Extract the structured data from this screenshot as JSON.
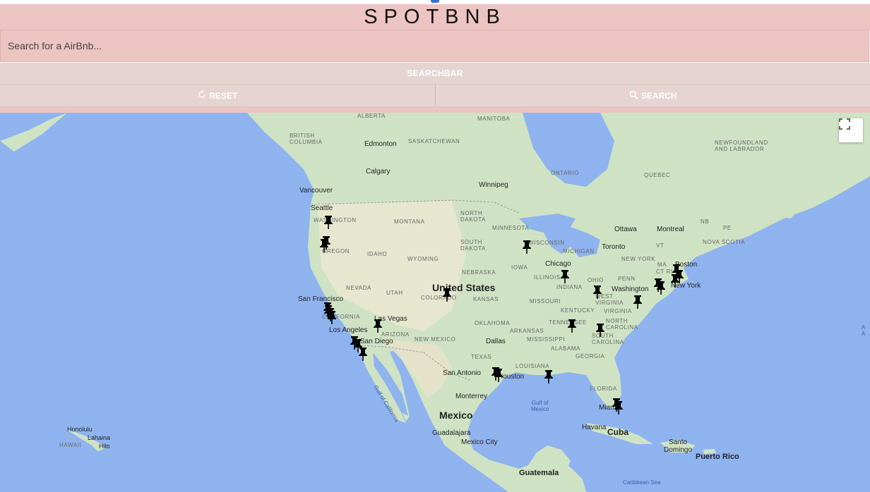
{
  "app": {
    "title": "SPOTBNB"
  },
  "search": {
    "placeholder": "Search for a AirBnb..."
  },
  "buttons": {
    "searchbar": "SEARCHBAR",
    "reset": "RESET",
    "search": "SEARCH"
  },
  "icons": {
    "reset": "refresh-icon",
    "search": "magnifier-icon",
    "fullscreen": "fullscreen-icon",
    "pin": "pushpin-icon"
  },
  "colors": {
    "header_bg": "#ecc4c2",
    "button_bg": "#e6d4d3",
    "ocean": "#8fb3ef",
    "land": "#cfe3c4",
    "pin": "#000000"
  },
  "map": {
    "labels": {
      "alberta": "ALBERTA",
      "manitoba": "MANITOBA",
      "british_columbia": "BRITISH\nCOLUMBIA",
      "saskatchewan": "SASKATCHEWAN",
      "edmonton": "Edmonton",
      "calgary": "Calgary",
      "ontario": "ONTARIO",
      "quebec": "QUEBEC",
      "newfoundland": "NEWFOUNDLAND\nAND LABRADOR",
      "winnipeg": "Winnipeg",
      "vancouver": "Vancouver",
      "seattle": "Seattle",
      "washington": "WASHINGTON",
      "montana": "MONTANA",
      "north_dakota": "NORTH\nDAKOTA",
      "minnesota": "MINNESOTA",
      "ottawa": "Ottawa",
      "montreal": "Montreal",
      "nb": "NB",
      "pe": "PE",
      "oregon": "OREGON",
      "idaho": "IDAHO",
      "wyoming": "WYOMING",
      "south_dakota": "SOUTH\nDAKOTA",
      "wisconsin": "WISCONSIN",
      "michigan": "MICHIGAN",
      "toronto": "Toronto",
      "vt": "VT",
      "nova_scotia": "NOVA SCOTIA",
      "new_york_state": "NEW YORK",
      "chicago": "Chicago",
      "nebraska": "NEBRASKA",
      "iowa": "IOWA",
      "ma": "MA",
      "boston": "Boston",
      "ct_ri": "CT RI",
      "new_york": "New York",
      "nevada": "NEVADA",
      "utah": "UTAH",
      "united_states": "United States",
      "illinois": "ILLINOIS",
      "indiana": "INDIANA",
      "ohio": "OHIO",
      "penn": "PENN",
      "washington_dc": "Washington",
      "san_francisco": "San Francisco",
      "colorado": "COLORADO",
      "kansas": "KANSAS",
      "missouri": "MISSOURI",
      "west_virginia": "WEST\nVIRGINIA",
      "virginia": "VIRGINIA",
      "california": "CALIFORNIA",
      "kentucky": "KENTUCKY",
      "las_vegas": "Las Vegas",
      "tennessee": "TENNESSEE",
      "north_carolina": "NORTH\nCAROLINA",
      "oklahoma": "OKLAHOMA",
      "los_angeles": "Los Angeles",
      "arizona": "ARIZONA",
      "arkansas": "ARKANSAS",
      "san_diego": "San Diego",
      "new_mexico": "NEW MEXICO",
      "dallas": "Dallas",
      "mississippi": "MISSISSIPPI",
      "south_carolina": "SOUTH\nCAROLINA",
      "alabama": "ALABAMA",
      "georgia": "GEORGIA",
      "texas": "TEXAS",
      "louisiana": "LOUISIANA",
      "san_antonio": "San Antonio",
      "houston": "Houston",
      "gulf_of_california": "Gulf of California",
      "florida": "FLORIDA",
      "monterrey": "Monterrey",
      "gulf_of_mexico": "Gulf of\nMexico",
      "miami": "Miami",
      "mexico": "Mexico",
      "honolulu": "Honolulu",
      "lahaina": "Lahaina",
      "hawaii": "HAWAII",
      "hilo": "Hilo",
      "havana": "Havana",
      "cuba": "Cuba",
      "guadalajara": "Guadalajara",
      "mexico_city": "Mexico City",
      "santo_domingo": "Santo\nDomingo",
      "puerto_rico": "Puerto Rico",
      "guatemala": "Guatemala",
      "caribbean_sea": "Caribbean Sea",
      "atlantic": "A\nA"
    }
  }
}
